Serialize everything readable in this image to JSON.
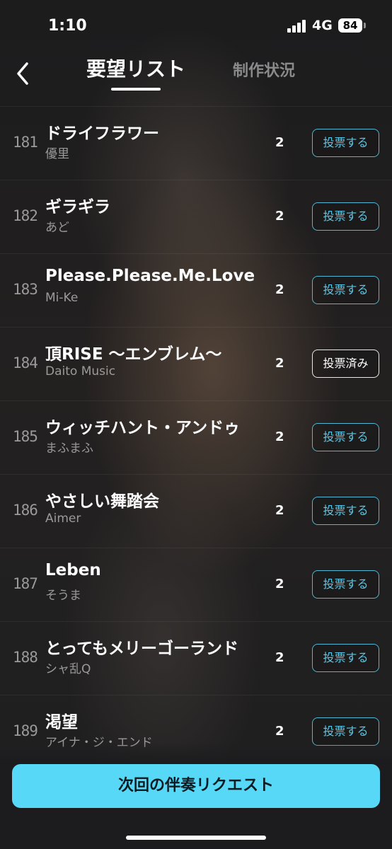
{
  "status_bar": {
    "time": "1:10",
    "network": "4G",
    "battery": "84"
  },
  "header": {
    "tabs": [
      {
        "label": "要望リスト",
        "active": true
      },
      {
        "label": "制作状況",
        "active": false
      }
    ]
  },
  "songs": [
    {
      "rank": "181",
      "title": "ドライフラワー",
      "artist": "優里",
      "votes": "2",
      "action": "投票する",
      "voted": false
    },
    {
      "rank": "182",
      "title": "ギラギラ",
      "artist": "あど",
      "votes": "2",
      "action": "投票する",
      "voted": false
    },
    {
      "rank": "183",
      "title": "Please.Please.Me.Love",
      "artist": "Mi-Ke",
      "votes": "2",
      "action": "投票する",
      "voted": false
    },
    {
      "rank": "184",
      "title": "頂RISE 〜エンブレム〜",
      "artist": "Daito Music",
      "votes": "2",
      "action": "投票済み",
      "voted": true
    },
    {
      "rank": "185",
      "title": "ウィッチハント・アンドゥ",
      "artist": "まふまふ",
      "votes": "2",
      "action": "投票する",
      "voted": false
    },
    {
      "rank": "186",
      "title": "やさしい舞踏会",
      "artist": "Aimer",
      "votes": "2",
      "action": "投票する",
      "voted": false
    },
    {
      "rank": "187",
      "title": "Leben",
      "artist": "そうま",
      "votes": "2",
      "action": "投票する",
      "voted": false
    },
    {
      "rank": "188",
      "title": "とってもメリーゴーランド",
      "artist": "シャ乱Q",
      "votes": "2",
      "action": "投票する",
      "voted": false
    },
    {
      "rank": "189",
      "title": "渇望",
      "artist": "アイナ・ジ・エンド",
      "votes": "2",
      "action": "投票する",
      "voted": false
    }
  ],
  "cta": {
    "label": "次回の伴奏リクエスト"
  },
  "colors": {
    "accent": "#56d8f6",
    "vote_border": "#4fb7d4",
    "background": "#1c1c1e"
  }
}
